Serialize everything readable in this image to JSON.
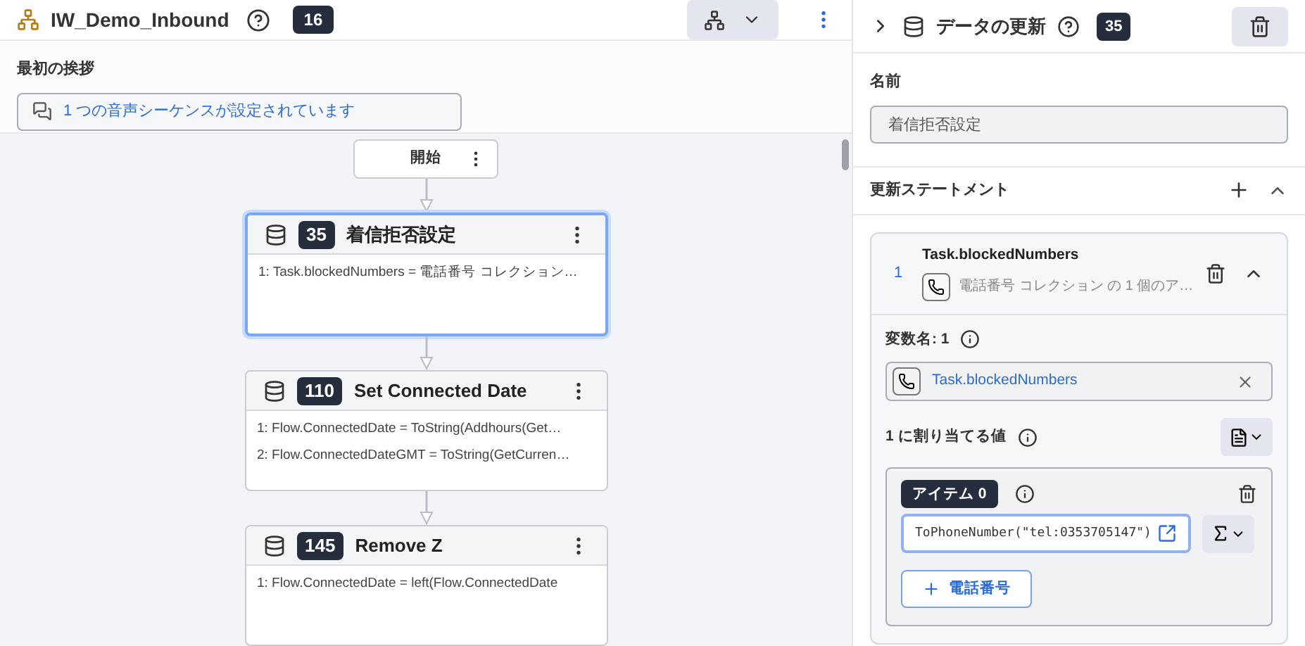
{
  "header": {
    "title": "IW_Demo_Inbound",
    "count": "16"
  },
  "greeting": {
    "label": "最初の挨拶",
    "value": "1 つの音声シーケンスが設定されています"
  },
  "flow": {
    "start": {
      "label": "開始"
    },
    "nodes": [
      {
        "badge": "35",
        "title": "着信拒否設定",
        "selected": true,
        "lines": [
          "1: Task.blockedNumbers = 電話番号 コレクション…"
        ]
      },
      {
        "badge": "110",
        "title": "Set Connected Date",
        "selected": false,
        "lines": [
          "1: Flow.ConnectedDate = ToString(Addhours(Get…",
          "2: Flow.ConnectedDateGMT = ToString(GetCurren…"
        ]
      },
      {
        "badge": "145",
        "title": "Remove Z",
        "selected": false,
        "lines": [
          "1: Flow.ConnectedDate = left(Flow.ConnectedDate"
        ]
      }
    ]
  },
  "panel": {
    "title": "データの更新",
    "count": "35",
    "name_label": "名前",
    "name_value": "着信拒否設定",
    "statements_label": "更新ステートメント",
    "statements_expanded": true,
    "statements": [
      {
        "number": "1",
        "variable": "Task.blockedNumbers",
        "summary": "電話番号 コレクション の 1 個のア…",
        "expanded": true,
        "variable_label": "変数名: 1",
        "variable_value": "Task.blockedNumbers",
        "value_label": "1 に割り当てる値",
        "items": [
          {
            "badge": "アイテム 0",
            "expression": "ToPhoneNumber(\"tel:0353705147\")"
          }
        ],
        "add_button": "電話番号"
      }
    ]
  }
}
